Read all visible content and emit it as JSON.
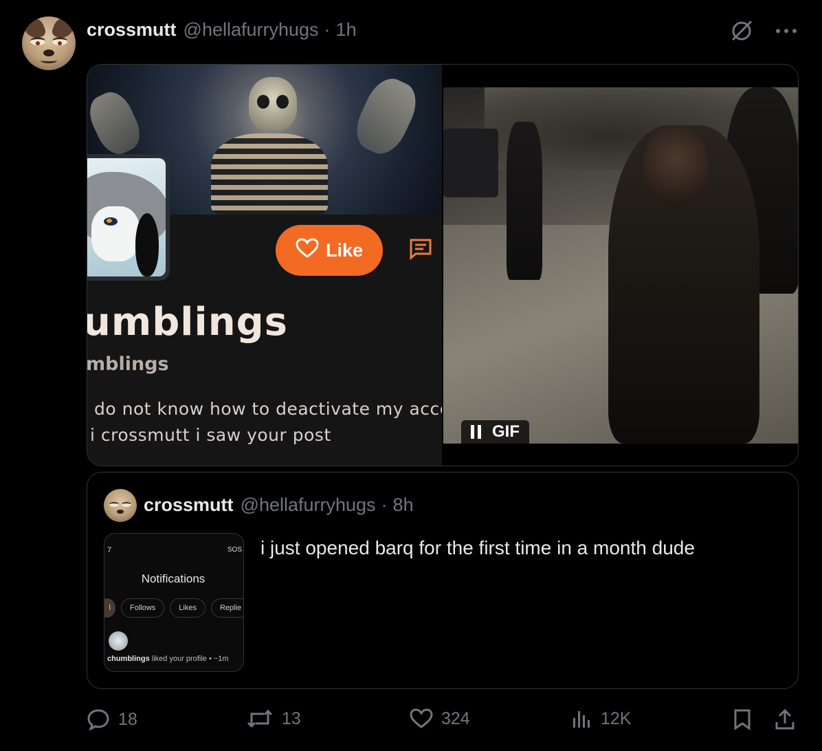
{
  "post": {
    "author_name": "crossmutt",
    "author_handle": "@hellafurryhugs",
    "separator": "·",
    "time": "1h"
  },
  "media_left": {
    "like_label": "Like",
    "profile_name": "umblings",
    "profile_handle": "mblings",
    "bio_line1": "do not know how to deactivate my acco",
    "bio_line2": "i crossmutt i saw your post"
  },
  "media_right": {
    "badge_label": "GIF"
  },
  "quote": {
    "author_name": "crossmutt",
    "author_handle": "@hellafurryhugs",
    "separator": "·",
    "time": "8h",
    "text": "i just opened barq for the first time in a month dude",
    "thumb": {
      "status_left": "7",
      "status_right": "SOS",
      "title": "Notifications",
      "chips": [
        "Follows",
        "Likes",
        "Replie"
      ],
      "first_chip": "l",
      "notification_user": "chumblings",
      "notification_text": "liked your profile",
      "notification_time": "• ~1m"
    }
  },
  "actions": {
    "replies": "18",
    "reposts": "13",
    "likes": "324",
    "views": "12K"
  },
  "colors": {
    "background": "#000000",
    "muted": "#71767b",
    "text": "#e7e9ea",
    "like_button": "#f36a22"
  },
  "icons": [
    "grok-slash-icon",
    "more-icon",
    "heart-icon",
    "chat-icon",
    "pause-icon",
    "reply-icon",
    "repost-icon",
    "like-icon",
    "views-icon",
    "bookmark-icon",
    "share-icon"
  ]
}
